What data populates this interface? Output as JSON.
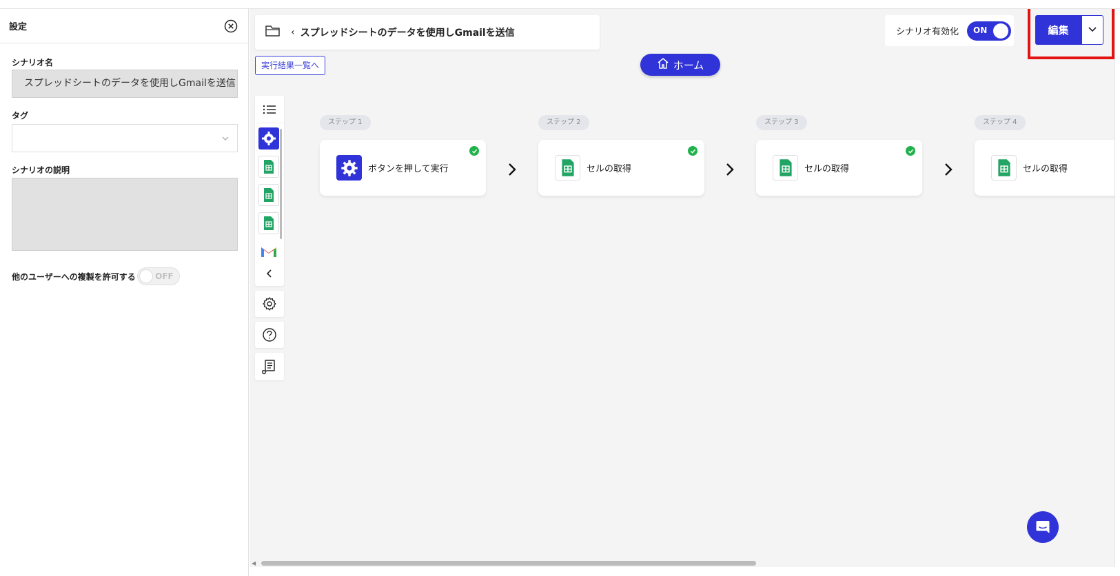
{
  "settings": {
    "title": "設定",
    "scenario_name_label": "シナリオ名",
    "scenario_name_value": "スプレッドシートのデータを使用しGmailを送信",
    "tag_label": "タグ",
    "description_label": "シナリオの説明",
    "copy_permission_label": "他のユーザーへの複製を許可する",
    "copy_permission_state": "OFF"
  },
  "header": {
    "scenario_title": "スプレッドシートのデータを使用しGmailを送信",
    "back_glyph": "‹",
    "results_link": "実行結果一覧へ",
    "home_label": "ホーム",
    "enable_label": "シナリオ有効化",
    "enable_state": "ON",
    "edit_label": "編集"
  },
  "steps": [
    {
      "pill": "ステップ 1",
      "name": "ボタンを押して実行",
      "icon": "gear-icon",
      "status": "success"
    },
    {
      "pill": "ステップ 2",
      "name": "セルの取得",
      "icon": "sheets-icon",
      "status": "success"
    },
    {
      "pill": "ステップ 3",
      "name": "セルの取得",
      "icon": "sheets-icon",
      "status": "success"
    },
    {
      "pill": "ステップ 4",
      "name": "セルの取得",
      "icon": "sheets-icon",
      "status": "success"
    }
  ],
  "colors": {
    "primary": "#2f33d8",
    "highlight": "#e31313",
    "success": "#21b24c",
    "canvas": "#f4f4f4"
  }
}
